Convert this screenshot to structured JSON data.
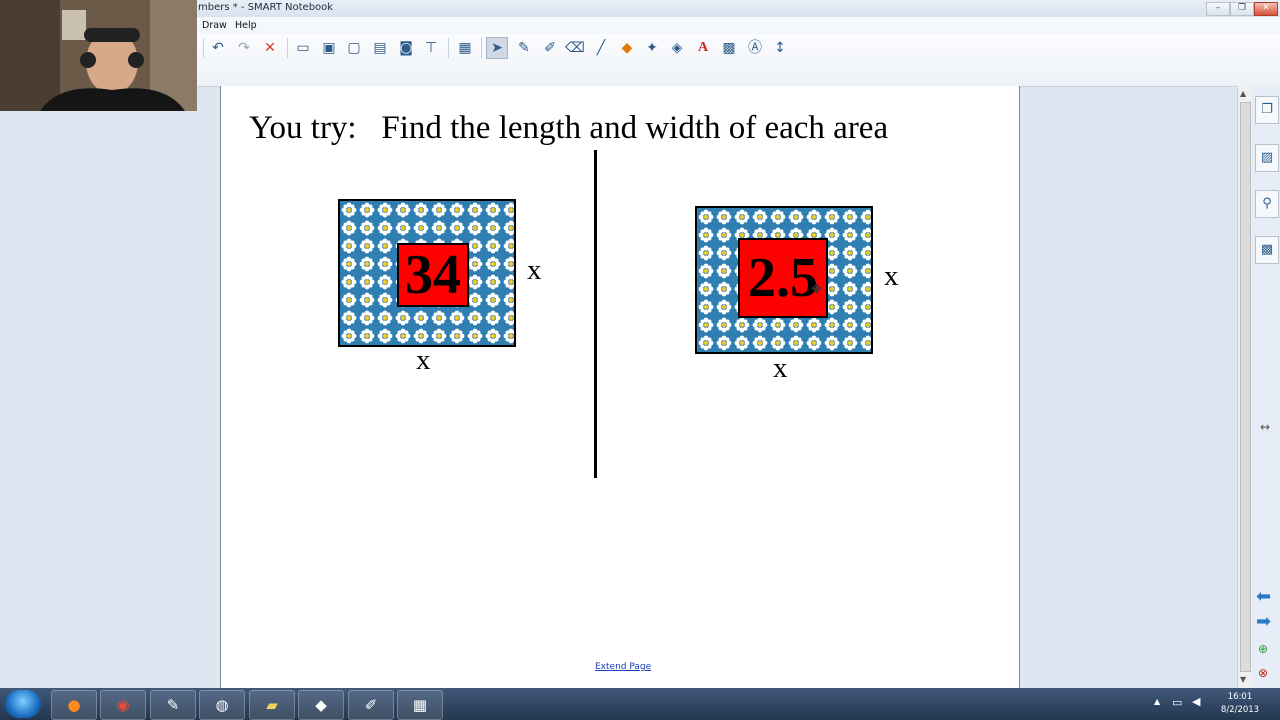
{
  "window": {
    "title": "mbers * - SMART Notebook"
  },
  "menu": {
    "items": [
      "Draw",
      "Help"
    ]
  },
  "page": {
    "title": "You try:   Find the length and width of each area",
    "left_figure": {
      "number": "34",
      "side_label": "x",
      "bottom_label": "x"
    },
    "right_figure": {
      "number": "2.5",
      "side_label": "x",
      "bottom_label": "x"
    },
    "extend_link": "Extend Page"
  },
  "clock": {
    "time": "16:01",
    "date": "8/2/2013"
  },
  "colors": {
    "tile_blue": "#2f7fb3",
    "number_red": "#ff0000",
    "link_blue": "#1a3fc0"
  }
}
